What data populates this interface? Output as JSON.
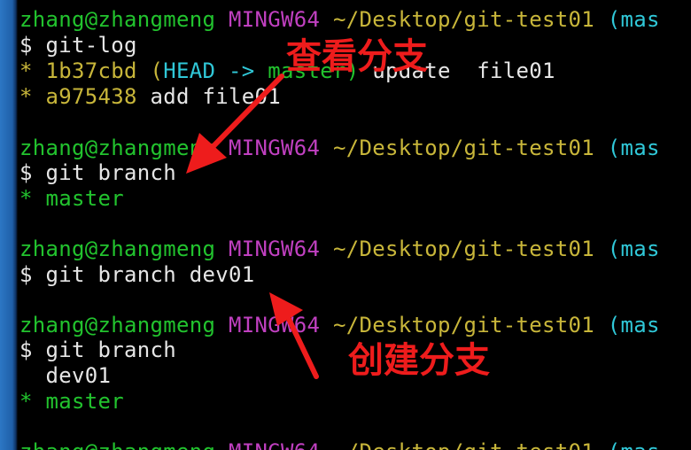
{
  "terminal": {
    "prompt_user": "zhang@zhangmeng",
    "prompt_sys": "MINGW64",
    "prompt_path": "~/Desktop/git-test01",
    "prompt_branch": "(mas",
    "dollar": "$",
    "cmd1": "git-log",
    "log1_bullet": "*",
    "log1_hash": "1b37cbd",
    "log1_open": "(",
    "log1_head": "HEAD ->",
    "log1_master": "master)",
    "log1_msg": "update  file01",
    "log2_bullet": "*",
    "log2_hash": "a975438",
    "log2_msg": "add file01",
    "cmd2": "git branch",
    "out2_bullet": "*",
    "out2_branch": "master",
    "cmd3": "git branch dev01",
    "cmd4": "git branch",
    "out4_branch1": "dev01",
    "out4_bullet": "*",
    "out4_branch2": "master"
  },
  "annotations": {
    "view_branches": "查看分支",
    "create_branch": "创建分支"
  },
  "colors": {
    "green": "#22c32e",
    "magenta": "#c040c0",
    "yellow": "#c8b63a",
    "cyan": "#30c8d8",
    "annotation_red": "#ee1c1c"
  }
}
